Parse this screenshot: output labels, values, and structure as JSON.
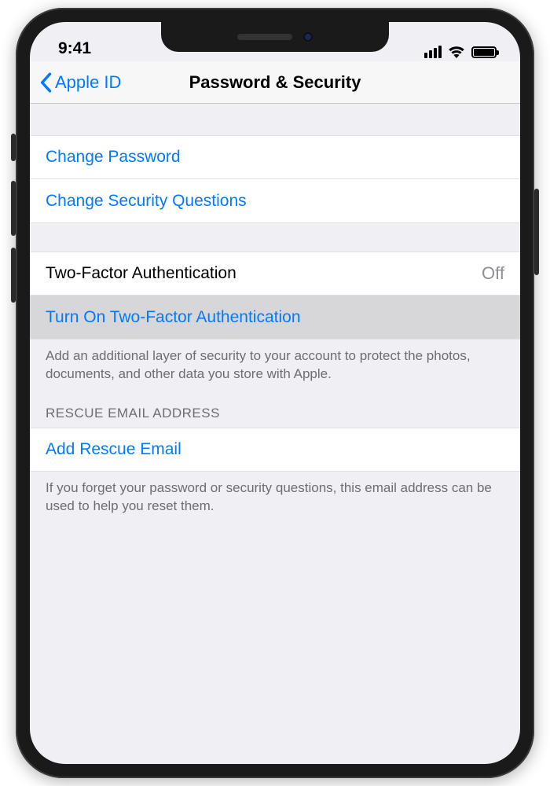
{
  "status": {
    "time": "9:41"
  },
  "nav": {
    "back_label": "Apple ID",
    "title": "Password & Security"
  },
  "rows": {
    "change_password": "Change Password",
    "change_security_questions": "Change Security Questions",
    "two_factor_label": "Two-Factor Authentication",
    "two_factor_value": "Off",
    "turn_on_two_factor": "Turn On Two-Factor Authentication",
    "two_factor_footer": "Add an additional layer of security to your account to protect the photos, documents, and other data you store with Apple.",
    "rescue_header": "RESCUE EMAIL ADDRESS",
    "add_rescue_email": "Add Rescue Email",
    "rescue_footer": "If you forget your password or security questions, this email address can be used to help you reset them."
  },
  "colors": {
    "link": "#007aff",
    "bg": "#efeff4",
    "cell_bg": "#ffffff",
    "separator": "#e1e1e3",
    "secondary_text": "#6d6d72",
    "value_text": "#8e8e93",
    "highlight_bg": "#d7d7da"
  }
}
